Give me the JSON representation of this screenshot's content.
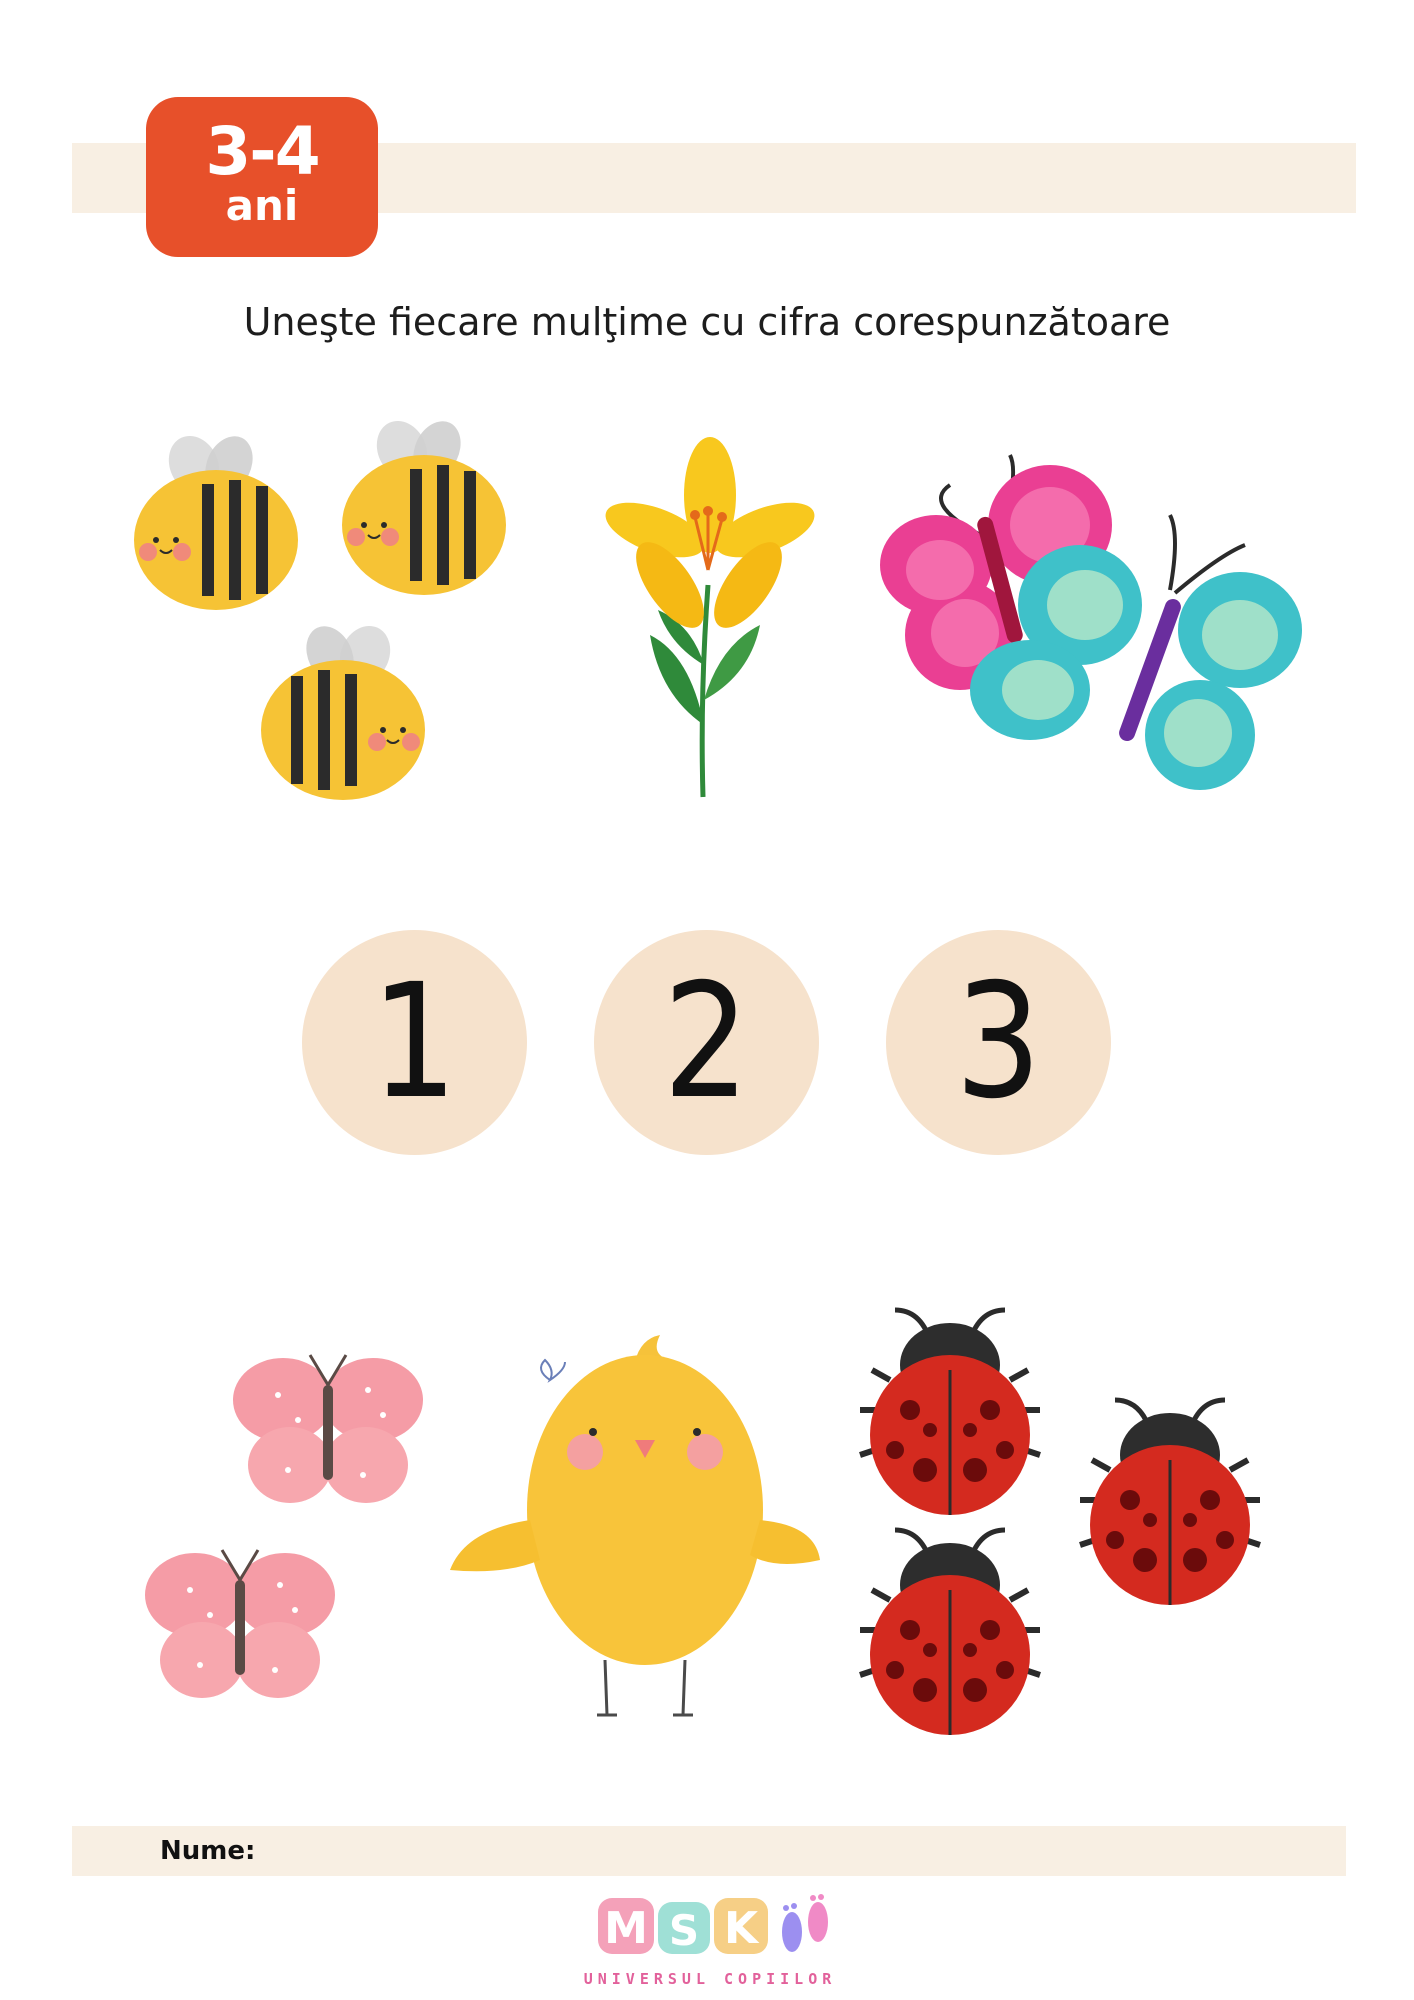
{
  "badge": {
    "age_range": "3-4",
    "age_unit": "ani"
  },
  "instruction": "Uneşte fiecare mulţime cu cifra corespunzătoare",
  "numbers": [
    "1",
    "2",
    "3"
  ],
  "top_sets": [
    {
      "item": "bee-icon",
      "count": 3
    },
    {
      "item": "flower-icon",
      "count": 1
    },
    {
      "item": "butterfly-icon",
      "count": 2
    }
  ],
  "bottom_sets": [
    {
      "item": "pink-butterfly-icon",
      "count": 2
    },
    {
      "item": "chick-icon",
      "count": 1
    },
    {
      "item": "ladybug-icon",
      "count": 3
    }
  ],
  "footer": {
    "name_label": "Nume:"
  },
  "logo": {
    "letters": [
      "M",
      "S",
      "K"
    ],
    "tagline": "UNIVERSUL COPIILOR"
  },
  "colors": {
    "badge": "#e7502a",
    "band": "#f8efe3",
    "number_circle": "#f6e2cc",
    "logo_pink": "#e2619b"
  }
}
